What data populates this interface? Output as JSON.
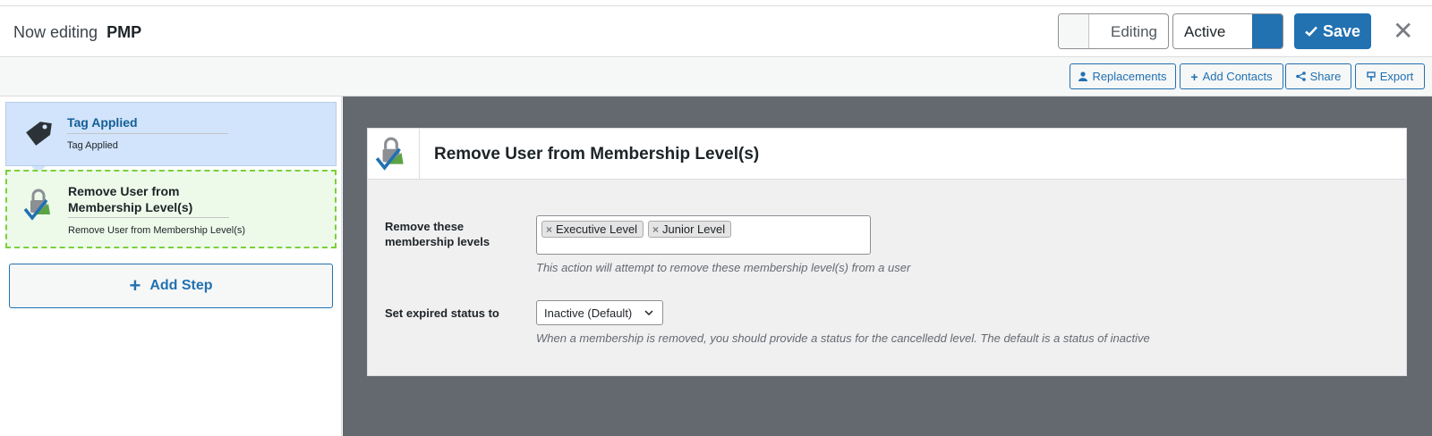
{
  "header": {
    "now_editing": "Now editing",
    "funnel_name": "PMP",
    "editing_label": "Editing",
    "active_label": "Active",
    "save_label": "Save"
  },
  "toolbar": {
    "replacements": "Replacements",
    "add_contacts": "Add Contacts",
    "share": "Share",
    "export": "Export"
  },
  "steps": [
    {
      "name": "Tag Applied",
      "description": "Tag Applied"
    },
    {
      "name_line1": "Remove User from",
      "name_line2": "Membership Level(s)",
      "description": "Remove User from Membership Level(s)"
    }
  ],
  "add_step_label": "Add Step",
  "panel": {
    "title": "Remove User from Membership Level(s)",
    "levels_label_line1": "Remove these",
    "levels_label_line2": "membership levels",
    "selected_levels": [
      "Executive Level",
      "Junior Level"
    ],
    "levels_help": "This action will attempt to remove these membership level(s) from a user",
    "status_label": "Set expired status to",
    "status_value": "Inactive (Default)",
    "status_help": "When a membership is removed, you should provide a status for the cancelledd level. The default is a status of inactive"
  },
  "colors": {
    "accent": "#2271b1",
    "active_step_bg": "#d1e4fb",
    "editing_step_bg": "#edfaea",
    "editing_step_border": "#7ad03a",
    "main_bg": "#646970"
  },
  "icons": [
    "check-icon",
    "close-icon",
    "user-icon",
    "plus-icon",
    "share-icon",
    "export-icon",
    "tag-icon",
    "pmp-logo-icon"
  ]
}
